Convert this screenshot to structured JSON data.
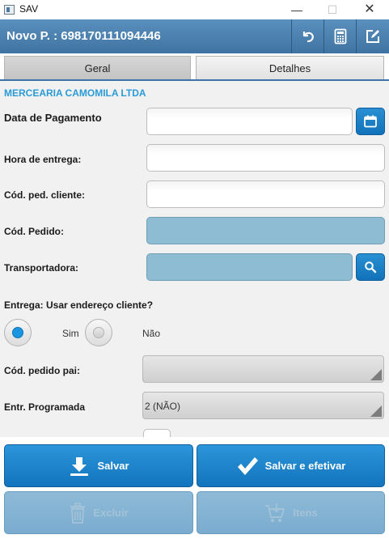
{
  "window": {
    "title": "SAV",
    "min_glyph": "—",
    "max_glyph": "☐",
    "close_glyph": "✕"
  },
  "header": {
    "order_label": "Novo P. : 698170111094446",
    "icons": [
      "undo-icon",
      "calculator-icon",
      "edit-icon"
    ]
  },
  "tabs": [
    {
      "label": "Geral",
      "active": true
    },
    {
      "label": "Detalhes",
      "active": false
    }
  ],
  "customer_name": "MERCEARIA CAMOMILA LTDA",
  "fields": {
    "payment_date": {
      "label": "Data de Pagamento",
      "value": ""
    },
    "delivery_time": {
      "label": "Hora de entrega:",
      "value": ""
    },
    "customer_order_code": {
      "label": "Cód. ped. cliente:",
      "value": ""
    },
    "order_code": {
      "label": "Cód. Pedido:",
      "value": ""
    },
    "carrier": {
      "label": "Transportadora:",
      "value": ""
    },
    "delivery_address": {
      "label": "Entrega: Usar endereço cliente?",
      "options": [
        {
          "label": "Sim",
          "selected": true
        },
        {
          "label": "Não",
          "selected": false
        }
      ]
    },
    "parent_order_code": {
      "label": "Cód. pedido pai:",
      "value": ""
    },
    "scheduled_delivery": {
      "label": "Entr. Programada",
      "value": "2 (NÃO)"
    }
  },
  "buttons": {
    "save": "Salvar",
    "save_and_confirm": "Salvar e efetivar",
    "delete": "Excluir",
    "items": "Itens"
  },
  "colors": {
    "header": "#4a80b0",
    "accent": "#1a8ad0",
    "customer_text": "#2a9bd6",
    "readonly_field": "#8dbcd3"
  }
}
